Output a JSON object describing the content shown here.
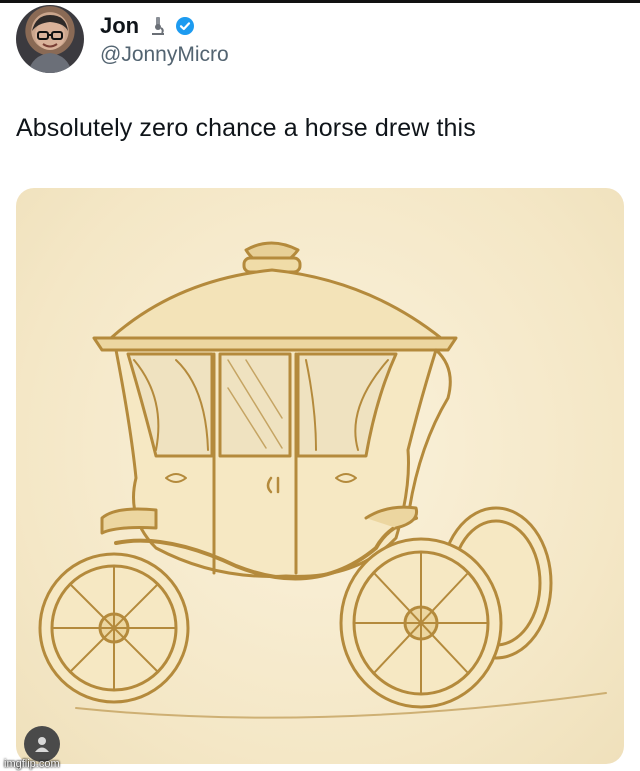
{
  "tweet": {
    "display_name": "Jon",
    "handle": "@JonnyMicro",
    "text": "Absolutely zero chance a horse drew this"
  },
  "icons": {
    "badge": "microscope-icon",
    "verified": "verified-badge-icon",
    "watermark_user": "user-icon"
  },
  "colors": {
    "verified": "#1d9bf0",
    "ink": "#b48a3c",
    "paper": "#f6ebcc"
  },
  "watermark": {
    "text": "imgflip.com"
  }
}
